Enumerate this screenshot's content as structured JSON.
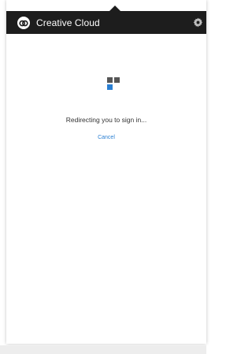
{
  "app": {
    "title": "Creative Cloud"
  },
  "content": {
    "status_message": "Redirecting you to sign in...",
    "cancel_label": "Cancel"
  },
  "icons": {
    "logo": "creative-cloud-logo-icon",
    "settings": "gear-icon",
    "loader": "loading-squares-icon"
  },
  "colors": {
    "header_bg": "#1d1d1d",
    "accent": "#2a7fd2",
    "loader_gray": "#565656"
  }
}
